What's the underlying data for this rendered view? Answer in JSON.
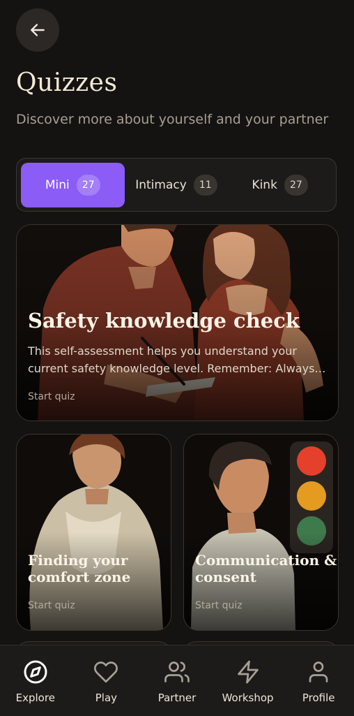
{
  "header": {
    "title": "Quizzes",
    "subtitle": "Discover more about yourself and your partner"
  },
  "tabs": [
    {
      "label": "Mini",
      "count": "27",
      "active": true
    },
    {
      "label": "Intimacy",
      "count": "11",
      "active": false
    },
    {
      "label": "Kink",
      "count": "27",
      "active": false
    }
  ],
  "cards": [
    {
      "title": "Safety knowledge check",
      "description": "This self-assessment helps you understand your current safety knowledge level. Remember: Always prioritize safety in every interaction.",
      "cta": "Start quiz"
    },
    {
      "title": "Finding your comfort zone",
      "cta": "Start quiz"
    },
    {
      "title": "Communication & consent",
      "cta": "Start quiz"
    }
  ],
  "nav": [
    {
      "label": "Explore",
      "icon": "compass-icon",
      "active": true
    },
    {
      "label": "Play",
      "icon": "heart-icon"
    },
    {
      "label": "Partner",
      "icon": "users-icon"
    },
    {
      "label": "Workshop",
      "icon": "lightning-icon"
    },
    {
      "label": "Profile",
      "icon": "user-icon"
    }
  ],
  "colors": {
    "background": "#151311",
    "accent": "#8b5cf6",
    "surface": "#1d1b19"
  }
}
